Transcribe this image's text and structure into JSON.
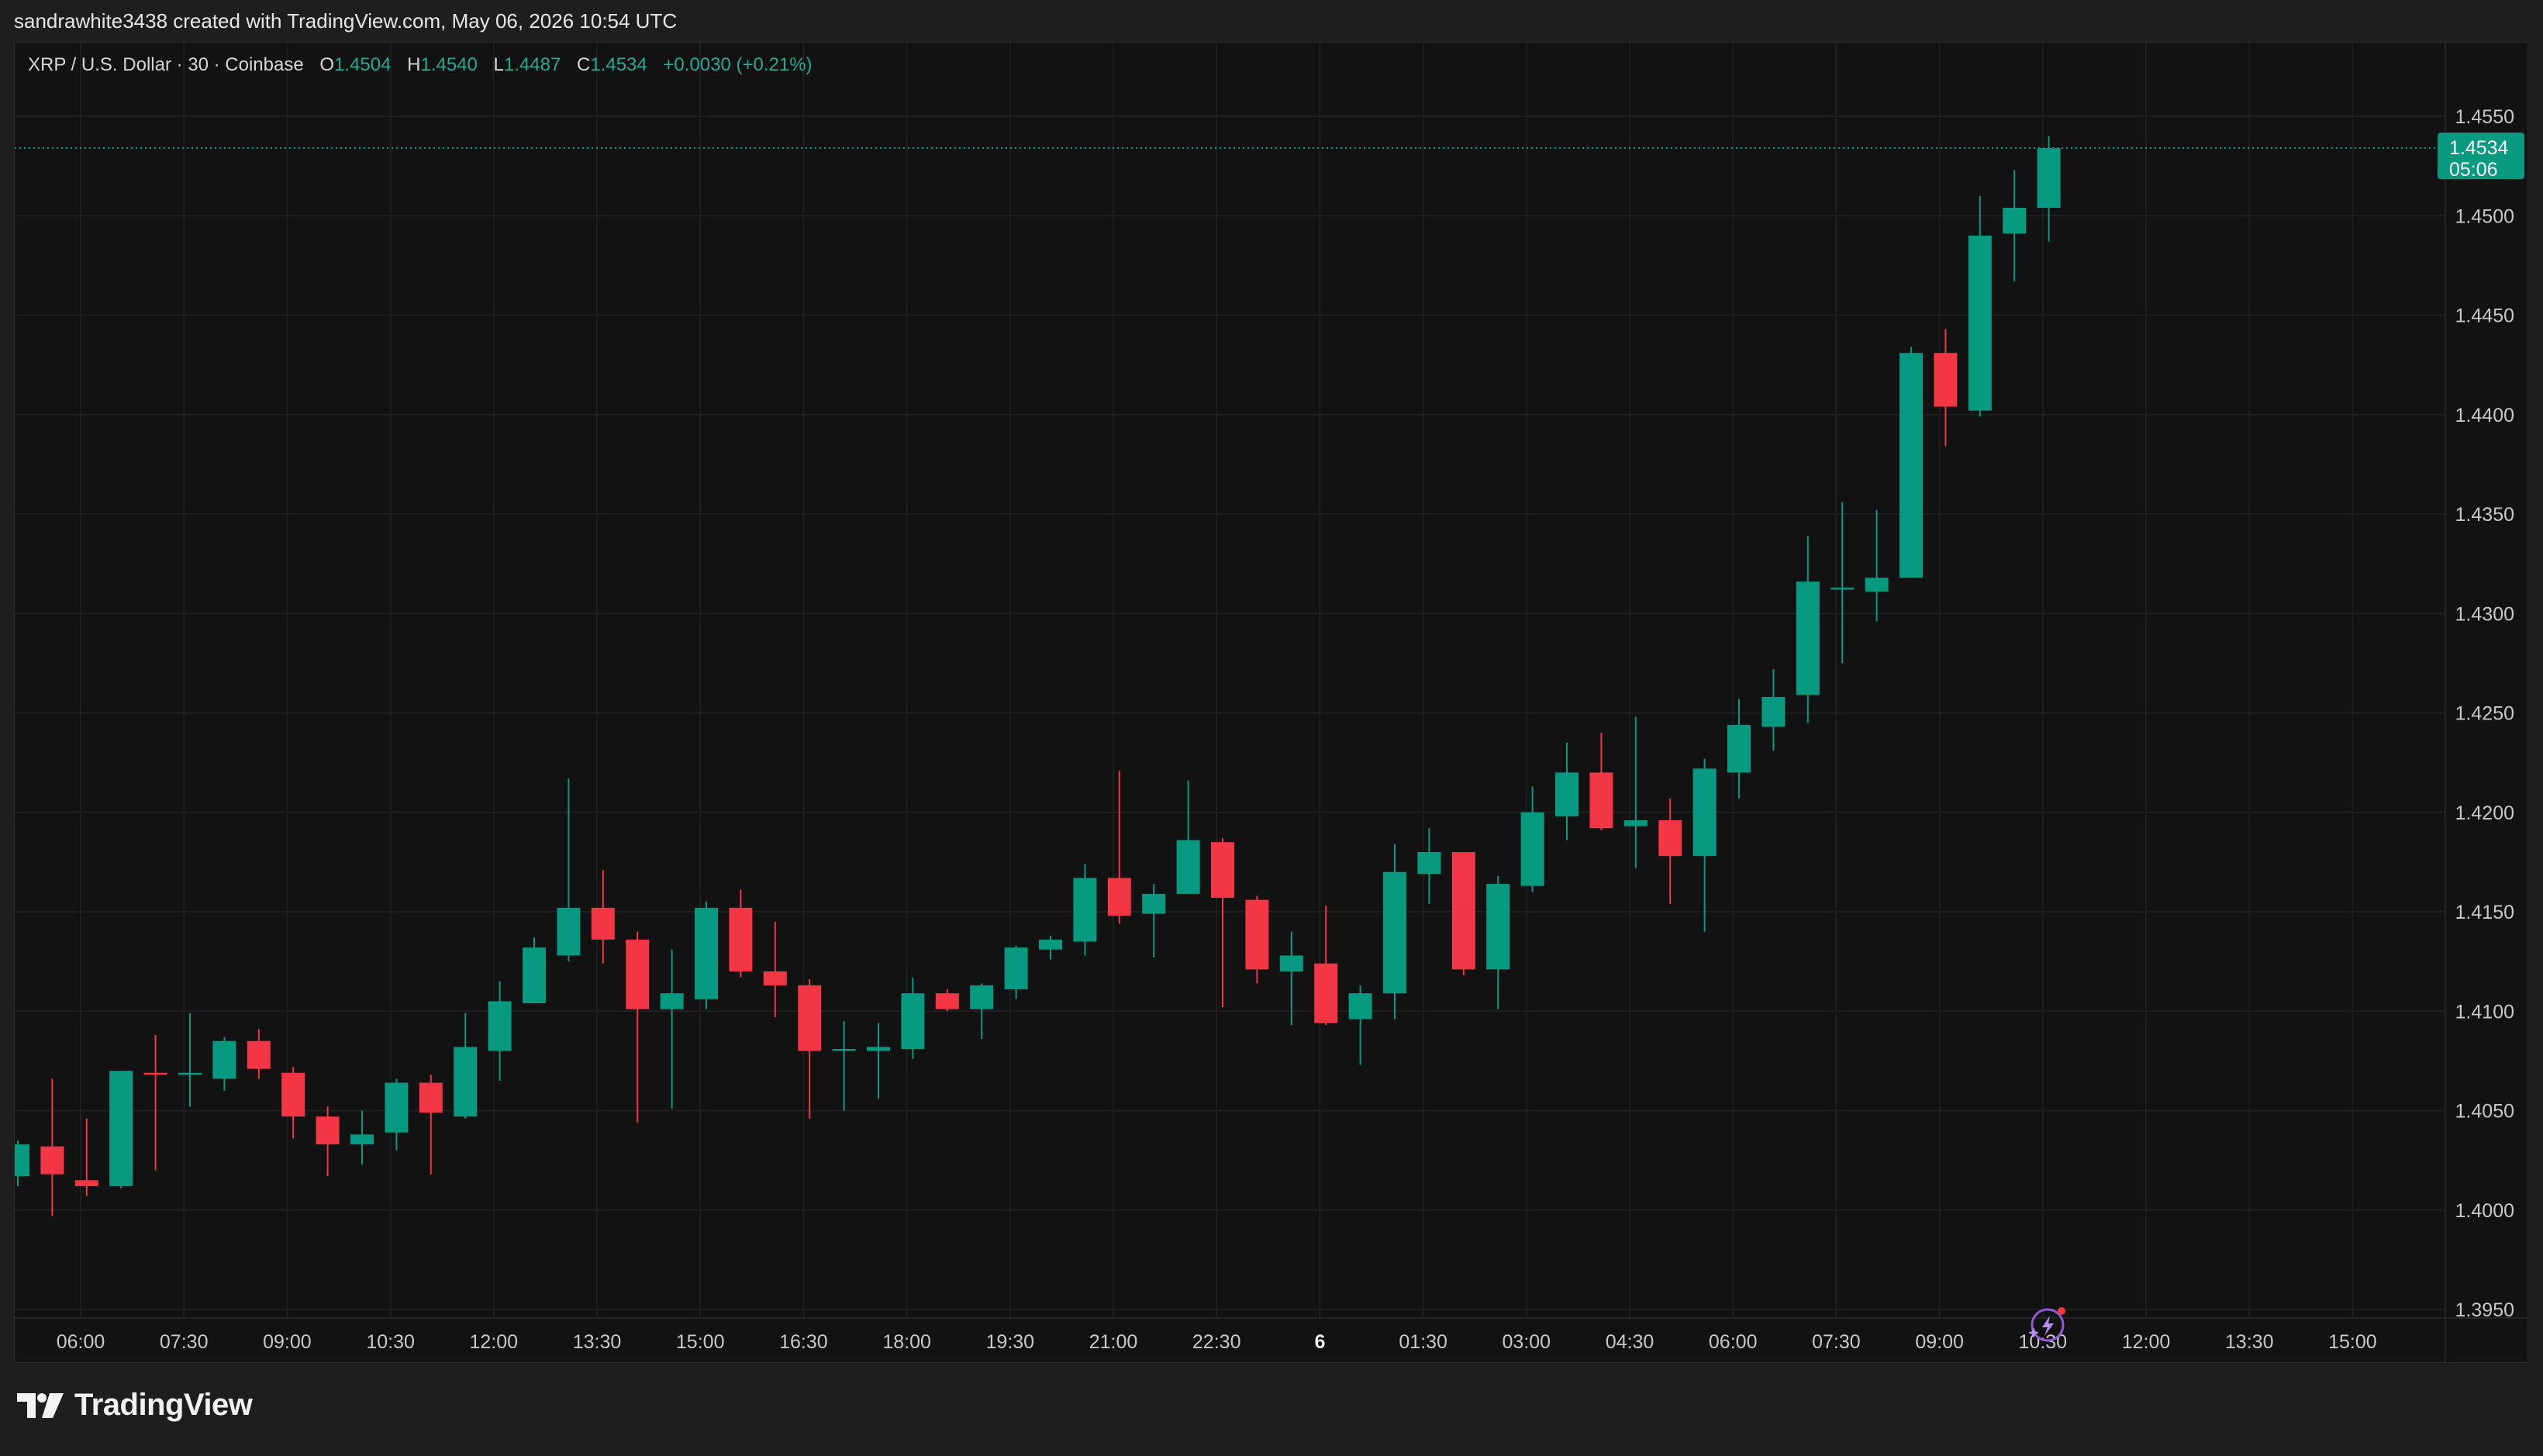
{
  "header": {
    "attribution": "sandrawhite3438 created with TradingView.com, May 06, 2026 10:54 UTC"
  },
  "legend": {
    "symbol": "XRP / U.S. Dollar · 30 · Coinbase",
    "open_label": "O",
    "open_value": "1.4504",
    "high_label": "H",
    "high_value": "1.4540",
    "low_label": "L",
    "low_value": "1.4487",
    "close_label": "C",
    "close_value": "1.4534",
    "change": "+0.0030 (+0.21%)"
  },
  "price_tag": {
    "price": "1.4534",
    "countdown": "05:06"
  },
  "footer": {
    "logo_text": "TradingView"
  },
  "colors": {
    "up": "#089981",
    "down": "#f23645",
    "grid": "#1f1f1f",
    "axis_text": "#c8c8c8",
    "background": "#121212"
  },
  "icons": {
    "logo": "tradingview-logo-icon",
    "lightning": "lightning-sparkle-icon"
  },
  "chart_data": {
    "type": "candlestick",
    "interval": "30",
    "y_ticks": [
      "1.4550",
      "1.4500",
      "1.4450",
      "1.4400",
      "1.4350",
      "1.4300",
      "1.4250",
      "1.4200",
      "1.4150",
      "1.4100",
      "1.4050",
      "1.4000",
      "1.3950"
    ],
    "x_ticks": [
      "06:00",
      "07:30",
      "09:00",
      "10:30",
      "12:00",
      "13:30",
      "15:00",
      "16:30",
      "18:00",
      "19:30",
      "21:00",
      "22:30",
      "6",
      "01:30",
      "03:00",
      "04:30",
      "06:00",
      "07:30",
      "09:00",
      "10:30",
      "12:00",
      "13:30",
      "15:00"
    ],
    "ylim": [
      1.395,
      1.455
    ],
    "last_price": 1.4534,
    "candles": [
      {
        "o": 1.4017,
        "h": 1.4035,
        "l": 1.4012,
        "c": 1.4033
      },
      {
        "o": 1.4032,
        "h": 1.4066,
        "l": 1.3997,
        "c": 1.4018
      },
      {
        "o": 1.4015,
        "h": 1.4046,
        "l": 1.4007,
        "c": 1.4012
      },
      {
        "o": 1.4012,
        "h": 1.407,
        "l": 1.4011,
        "c": 1.407
      },
      {
        "o": 1.4069,
        "h": 1.4088,
        "l": 1.402,
        "c": 1.4068
      },
      {
        "o": 1.4068,
        "h": 1.4099,
        "l": 1.4052,
        "c": 1.4069
      },
      {
        "o": 1.4066,
        "h": 1.4087,
        "l": 1.406,
        "c": 1.4085
      },
      {
        "o": 1.4085,
        "h": 1.4091,
        "l": 1.4066,
        "c": 1.4071
      },
      {
        "o": 1.4069,
        "h": 1.4072,
        "l": 1.4036,
        "c": 1.4047
      },
      {
        "o": 1.4047,
        "h": 1.4052,
        "l": 1.4017,
        "c": 1.4033
      },
      {
        "o": 1.4033,
        "h": 1.405,
        "l": 1.4023,
        "c": 1.4038
      },
      {
        "o": 1.4039,
        "h": 1.4066,
        "l": 1.403,
        "c": 1.4064
      },
      {
        "o": 1.4064,
        "h": 1.4068,
        "l": 1.4018,
        "c": 1.4049
      },
      {
        "o": 1.4047,
        "h": 1.4099,
        "l": 1.4046,
        "c": 1.4082
      },
      {
        "o": 1.408,
        "h": 1.4115,
        "l": 1.4065,
        "c": 1.4105
      },
      {
        "o": 1.4104,
        "h": 1.4137,
        "l": 1.4104,
        "c": 1.4132
      },
      {
        "o": 1.4128,
        "h": 1.4217,
        "l": 1.4125,
        "c": 1.4152
      },
      {
        "o": 1.4152,
        "h": 1.4171,
        "l": 1.4124,
        "c": 1.4136
      },
      {
        "o": 1.4136,
        "h": 1.414,
        "l": 1.4044,
        "c": 1.4101
      },
      {
        "o": 1.4101,
        "h": 1.4131,
        "l": 1.4051,
        "c": 1.4109
      },
      {
        "o": 1.4106,
        "h": 1.4155,
        "l": 1.4101,
        "c": 1.4152
      },
      {
        "o": 1.4152,
        "h": 1.4161,
        "l": 1.4117,
        "c": 1.412
      },
      {
        "o": 1.412,
        "h": 1.4145,
        "l": 1.4097,
        "c": 1.4113
      },
      {
        "o": 1.4113,
        "h": 1.4116,
        "l": 1.4046,
        "c": 1.408
      },
      {
        "o": 1.408,
        "h": 1.4095,
        "l": 1.405,
        "c": 1.4081
      },
      {
        "o": 1.408,
        "h": 1.4094,
        "l": 1.4056,
        "c": 1.4082
      },
      {
        "o": 1.4081,
        "h": 1.4117,
        "l": 1.4076,
        "c": 1.4109
      },
      {
        "o": 1.4109,
        "h": 1.4111,
        "l": 1.41,
        "c": 1.4101
      },
      {
        "o": 1.4101,
        "h": 1.4114,
        "l": 1.4086,
        "c": 1.4113
      },
      {
        "o": 1.4111,
        "h": 1.4133,
        "l": 1.4106,
        "c": 1.4132
      },
      {
        "o": 1.4131,
        "h": 1.4138,
        "l": 1.4126,
        "c": 1.4136
      },
      {
        "o": 1.4135,
        "h": 1.4174,
        "l": 1.4128,
        "c": 1.4167
      },
      {
        "o": 1.4167,
        "h": 1.4221,
        "l": 1.4144,
        "c": 1.4148
      },
      {
        "o": 1.4149,
        "h": 1.4164,
        "l": 1.4127,
        "c": 1.4159
      },
      {
        "o": 1.4159,
        "h": 1.4216,
        "l": 1.4159,
        "c": 1.4186
      },
      {
        "o": 1.4185,
        "h": 1.4187,
        "l": 1.4102,
        "c": 1.4157
      },
      {
        "o": 1.4156,
        "h": 1.4158,
        "l": 1.4114,
        "c": 1.4121
      },
      {
        "o": 1.412,
        "h": 1.414,
        "l": 1.4093,
        "c": 1.4128
      },
      {
        "o": 1.4124,
        "h": 1.4153,
        "l": 1.4093,
        "c": 1.4094
      },
      {
        "o": 1.4096,
        "h": 1.4113,
        "l": 1.4073,
        "c": 1.4109
      },
      {
        "o": 1.4109,
        "h": 1.4184,
        "l": 1.4096,
        "c": 1.417
      },
      {
        "o": 1.4169,
        "h": 1.4192,
        "l": 1.4154,
        "c": 1.418
      },
      {
        "o": 1.418,
        "h": 1.418,
        "l": 1.4118,
        "c": 1.4121
      },
      {
        "o": 1.4121,
        "h": 1.4168,
        "l": 1.4101,
        "c": 1.4164
      },
      {
        "o": 1.4163,
        "h": 1.4213,
        "l": 1.416,
        "c": 1.42
      },
      {
        "o": 1.4198,
        "h": 1.4235,
        "l": 1.4186,
        "c": 1.422
      },
      {
        "o": 1.422,
        "h": 1.424,
        "l": 1.4191,
        "c": 1.4192
      },
      {
        "o": 1.4193,
        "h": 1.4248,
        "l": 1.4172,
        "c": 1.4196
      },
      {
        "o": 1.4196,
        "h": 1.4207,
        "l": 1.4154,
        "c": 1.4178
      },
      {
        "o": 1.4178,
        "h": 1.4227,
        "l": 1.414,
        "c": 1.4222
      },
      {
        "o": 1.422,
        "h": 1.4257,
        "l": 1.4207,
        "c": 1.4244
      },
      {
        "o": 1.4243,
        "h": 1.4272,
        "l": 1.4231,
        "c": 1.4258
      },
      {
        "o": 1.4259,
        "h": 1.4339,
        "l": 1.4245,
        "c": 1.4316
      },
      {
        "o": 1.4312,
        "h": 1.4356,
        "l": 1.4275,
        "c": 1.4313
      },
      {
        "o": 1.4311,
        "h": 1.4352,
        "l": 1.4296,
        "c": 1.4318
      },
      {
        "o": 1.4318,
        "h": 1.4434,
        "l": 1.4318,
        "c": 1.4431
      },
      {
        "o": 1.4431,
        "h": 1.4443,
        "l": 1.4384,
        "c": 1.4404
      },
      {
        "o": 1.4402,
        "h": 1.451,
        "l": 1.4399,
        "c": 1.449
      },
      {
        "o": 1.4491,
        "h": 1.4523,
        "l": 1.4467,
        "c": 1.4504
      },
      {
        "o": 1.4504,
        "h": 1.454,
        "l": 1.4487,
        "c": 1.4534
      }
    ]
  }
}
